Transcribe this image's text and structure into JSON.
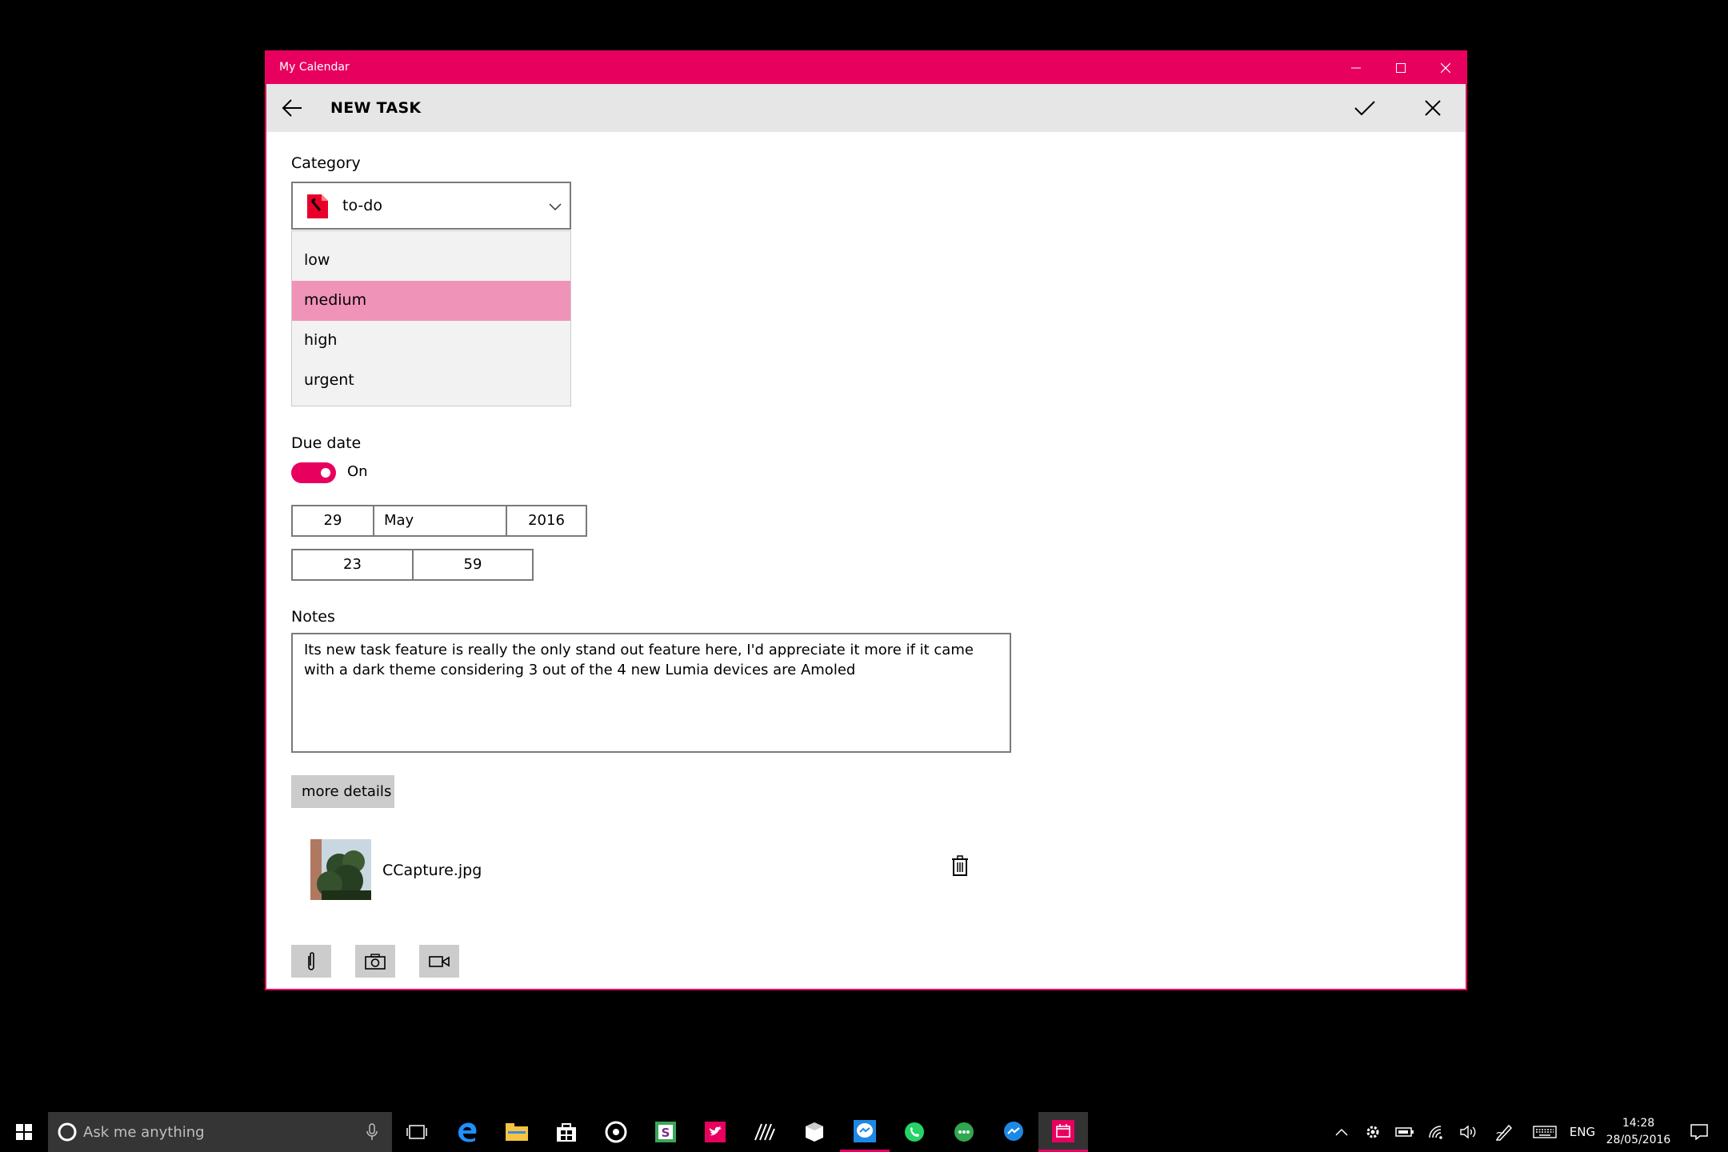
{
  "window": {
    "title": "My Calendar",
    "accent": "#e8005f"
  },
  "header": {
    "title": "NEW TASK",
    "back_icon": "arrow-left-icon",
    "save_icon": "checkmark-icon",
    "cancel_icon": "close-icon"
  },
  "category": {
    "label": "Category",
    "selected": "to-do",
    "options": [
      "low",
      "medium",
      "high",
      "urgent"
    ],
    "highlighted": "medium",
    "highlight_color": "#f093b8"
  },
  "due_date": {
    "label": "Due date",
    "toggle_state": "On",
    "day": "29",
    "month": "May",
    "year": "2016",
    "hour": "23",
    "minute": "59"
  },
  "notes": {
    "label": "Notes",
    "value": "Its new task feature is really the only stand out feature here, I'd appreciate it more if it came with a dark theme considering 3 out of the 4 new Lumia devices are Amoled"
  },
  "more_details_label": "more details",
  "attachment": {
    "filename": "CCapture.jpg"
  },
  "taskbar": {
    "search_placeholder": "Ask me anything",
    "language": "ENG",
    "time": "14:28",
    "date": "28/05/2016"
  }
}
